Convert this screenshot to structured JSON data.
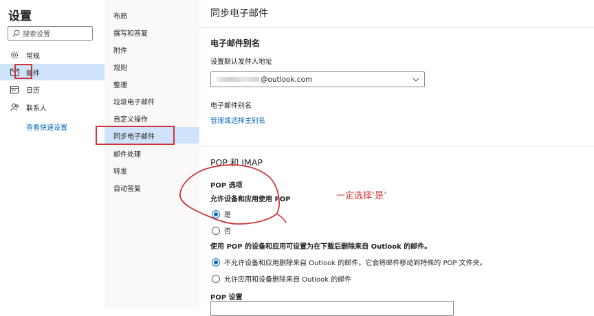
{
  "settings": {
    "title": "设置",
    "search_placeholder": "搜索设置",
    "nav": [
      {
        "label": "常规",
        "icon": "gear-icon"
      },
      {
        "label": "邮件",
        "icon": "mail-icon"
      },
      {
        "label": "日历",
        "icon": "calendar-icon"
      },
      {
        "label": "联系人",
        "icon": "people-icon"
      }
    ],
    "quick_link": "查看快速设置"
  },
  "mail_menu": [
    "布局",
    "撰写和答复",
    "附件",
    "规则",
    "整理",
    "垃圾电子邮件",
    "自定义操作",
    "同步电子邮件",
    "邮件处理",
    "转发",
    "自动答复"
  ],
  "panel": {
    "heading": "同步电子邮件",
    "alias_section": "电子邮件别名",
    "default_from_label": "设置默认发件人地址",
    "from_address": "@outlook.com",
    "alias_label": "电子邮件别名",
    "manage_alias_link": "管理或选择主别名",
    "pop_imap_section": "POP 和 IMAP",
    "pop_options_label": "POP 选项",
    "allow_pop_label": "允许设备和应用使用 POP",
    "yes_label": "是",
    "no_label": "否",
    "delete_question": "使用 POP 的设备和应用可设置为在下载后删除来自 Outlook 的邮件。",
    "no_delete_option": "不允许设备和应用删除来自 Outlook 的邮件。它会将邮件移动到特殊的 POP 文件夹。",
    "allow_delete_option": "允许应用和设备删除来自 Outlook 的邮件",
    "pop_settings_label": "POP 设置"
  },
  "annotation": {
    "text": "一定选择‘是’",
    "color": "#d13438"
  },
  "colors": {
    "accent": "#0f6cbd",
    "selected_bg": "#cfe4fa",
    "highlight_red": "#d13438"
  }
}
